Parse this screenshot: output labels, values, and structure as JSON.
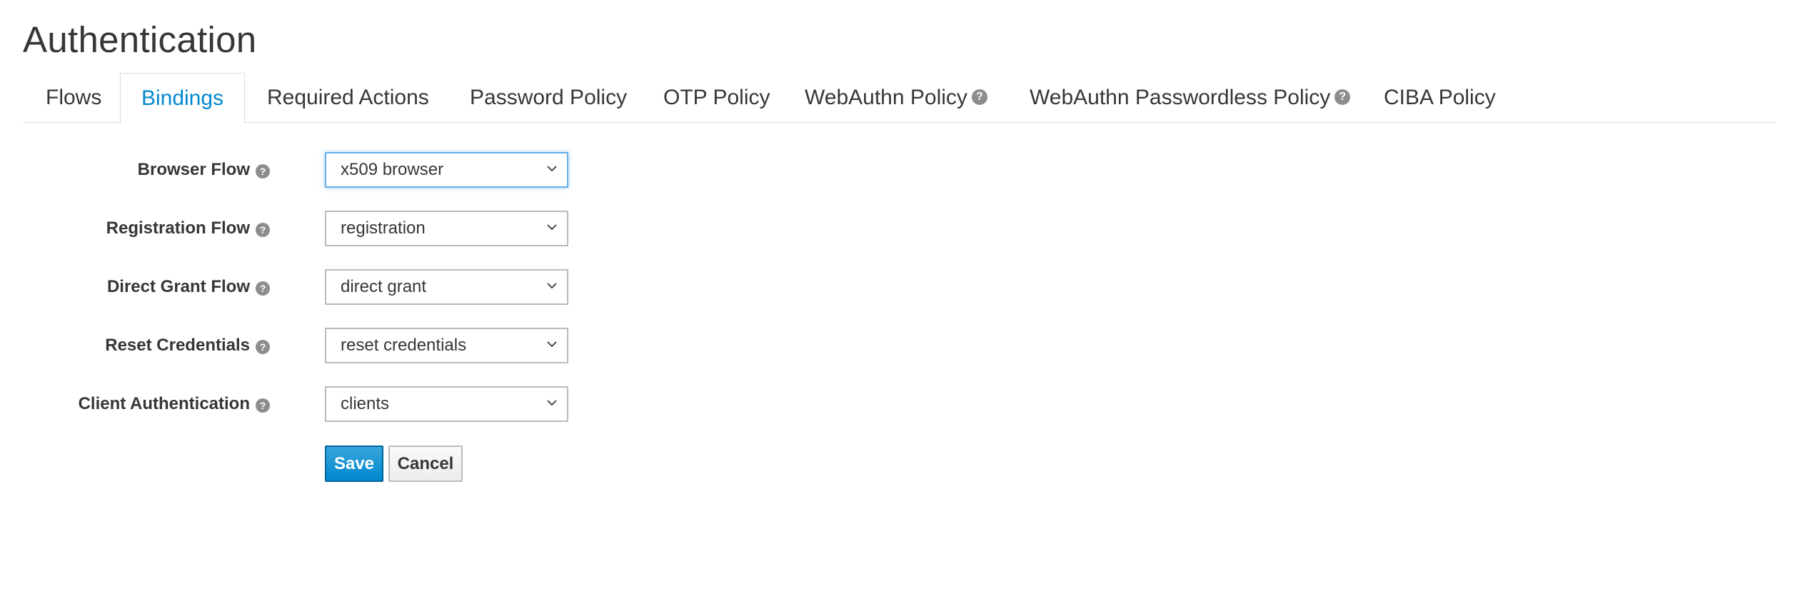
{
  "page": {
    "title": "Authentication"
  },
  "tabs": [
    {
      "label": "Flows",
      "active": false,
      "help": false
    },
    {
      "label": "Bindings",
      "active": true,
      "help": false
    },
    {
      "label": "Required Actions",
      "active": false,
      "help": false
    },
    {
      "label": "Password Policy",
      "active": false,
      "help": false
    },
    {
      "label": "OTP Policy",
      "active": false,
      "help": false
    },
    {
      "label": "WebAuthn Policy",
      "active": false,
      "help": true
    },
    {
      "label": "WebAuthn Passwordless Policy",
      "active": false,
      "help": true
    },
    {
      "label": "CIBA Policy",
      "active": false,
      "help": false
    }
  ],
  "form": {
    "fields": [
      {
        "label": "Browser Flow",
        "value": "x509 browser",
        "focused": true
      },
      {
        "label": "Registration Flow",
        "value": "registration",
        "focused": false
      },
      {
        "label": "Direct Grant Flow",
        "value": "direct grant",
        "focused": false
      },
      {
        "label": "Reset Credentials",
        "value": "reset credentials",
        "focused": false
      },
      {
        "label": "Client Authentication",
        "value": "clients",
        "focused": false
      }
    ],
    "save_label": "Save",
    "cancel_label": "Cancel"
  },
  "icons": {
    "help": "question-circle-icon",
    "select_arrow": "chevron-down-icon"
  },
  "colors": {
    "accent": "#0088ce",
    "focus_border": "#66afe9",
    "help_icon": "#8b8d8f",
    "text": "#363636"
  }
}
